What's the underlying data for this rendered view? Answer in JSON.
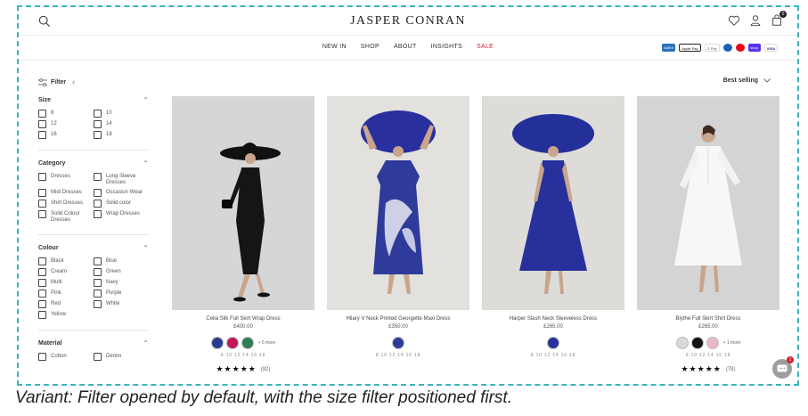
{
  "header": {
    "brand": "JASPER CONRAN",
    "cart_count": "0"
  },
  "nav": {
    "items": [
      "NEW IN",
      "SHOP",
      "ABOUT",
      "INSIGHTS",
      "SALE"
    ]
  },
  "payments": {
    "items": [
      "AMEX",
      "Apple Pay",
      "G Pay",
      "Maestro",
      "Mastercard",
      "shop",
      "VISA"
    ]
  },
  "toolbar": {
    "filter_label": "Filter",
    "sort_label": "Best selling"
  },
  "filters": {
    "size": {
      "title": "Size",
      "options": [
        "8",
        "10",
        "12",
        "14",
        "16",
        "18"
      ]
    },
    "category": {
      "title": "Category",
      "options": [
        "Dresses",
        "Long Sleeve Dresses",
        "Midi Dresses",
        "Occasion Wear",
        "Shirt Dresses",
        "Solid color",
        "Solid Colour Dresses",
        "Wrap Dresses"
      ]
    },
    "colour": {
      "title": "Colour",
      "options": [
        "Black",
        "Blue",
        "Cream",
        "Green",
        "Multi",
        "Navy",
        "Pink",
        "Purple",
        "Red",
        "White",
        "Yellow"
      ]
    },
    "material": {
      "title": "Material",
      "options": [
        "Cotton",
        "Denim"
      ]
    }
  },
  "products": [
    {
      "title": "Celia Silk Full Skirt Wrap Dress",
      "price": "£400.00",
      "swatches": [
        "#2b3b8f",
        "#c2185b",
        "#2e7d57"
      ],
      "more": "+ 5 more",
      "sizes": "8 10 12 14 16 18",
      "stars": "★★★★★",
      "reviews": "(82)",
      "photo_color": "#d6d6d6"
    },
    {
      "title": "Hilary V Neck Printed Georgette Maxi Dress",
      "price": "£350.00",
      "swatches": [
        "#2f3b9a"
      ],
      "more": "",
      "sizes": "8 10 12 14 16 18",
      "stars": "",
      "reviews": "",
      "photo_color": "#e2e1dd"
    },
    {
      "title": "Harper Slash Neck Sleeveless Dress",
      "price": "£265.00",
      "swatches": [
        "#27309b"
      ],
      "more": "",
      "sizes": "8 10 12 14 16 18",
      "stars": "",
      "reviews": "",
      "photo_color": "#dddcd8"
    },
    {
      "title": "Blythe Full Skirt Shirt Dress",
      "price": "£265.00",
      "swatches": [
        "#d9d9d9",
        "#111111",
        "#e9b7c5"
      ],
      "more": "+ 1 more",
      "sizes": "8 10 12 14 16 18",
      "stars": "★★★★★",
      "reviews": "(78)",
      "photo_color": "#d4d4d4"
    }
  ],
  "chat": {
    "badge": "1"
  },
  "caption": "Variant: Filter opened by default, with the size filter positioned first.",
  "colors": {
    "frame": "#3bb3c3",
    "sale": "#d3212d",
    "accent": "#2b35a0"
  }
}
